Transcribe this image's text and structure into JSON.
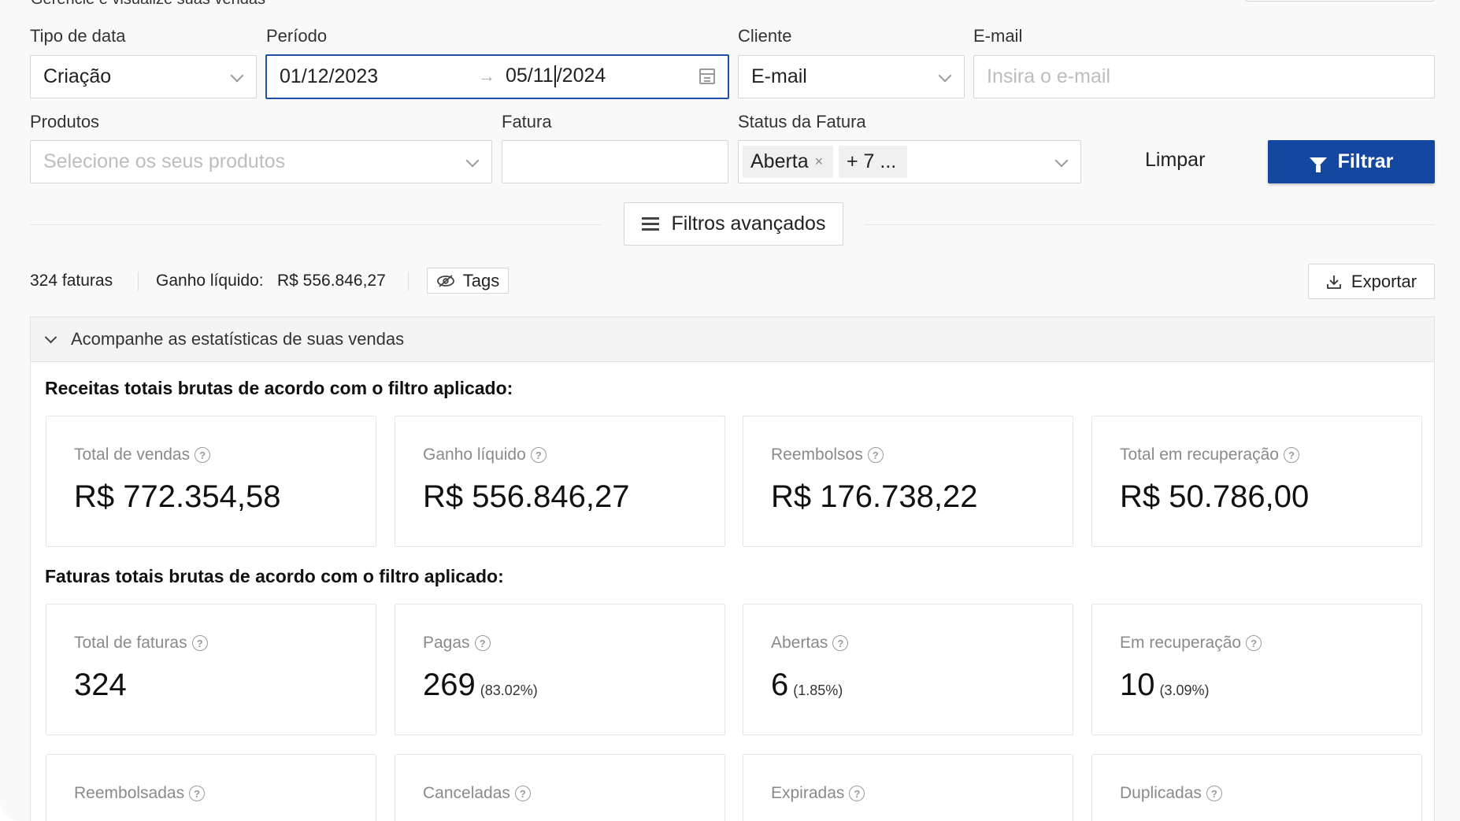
{
  "header": {
    "subtitle": "Gerencie e visualize suas vendas"
  },
  "filters": {
    "date_type": {
      "label": "Tipo de data",
      "value": "Criação"
    },
    "period": {
      "label": "Período",
      "start": "01/12/2023",
      "end_before_caret": "05/11",
      "end_after_caret": "/2024",
      "arrow": "→"
    },
    "client": {
      "label": "Cliente",
      "value": "E-mail"
    },
    "email": {
      "label": "E-mail",
      "placeholder": "Insira o e-mail"
    },
    "products": {
      "label": "Produtos",
      "placeholder": "Selecione os seus produtos"
    },
    "invoice": {
      "label": "Fatura",
      "value": ""
    },
    "invoice_status": {
      "label": "Status da Fatura",
      "tags": [
        "Aberta",
        "+ 7 ..."
      ],
      "remove_glyph": "×"
    },
    "clear_label": "Limpar",
    "filter_label": "Filtrar",
    "advanced_label": "Filtros avançados"
  },
  "summary": {
    "invoices_count": "324 faturas",
    "net_gain_label": "Ganho líquido:",
    "net_gain_value": "R$ 556.846,27",
    "tags_label": "Tags",
    "export_label": "Exportar"
  },
  "stats": {
    "panel_title": "Acompanhe as estatísticas de suas vendas",
    "revenue_title": "Receitas totais brutas de acordo com o filtro aplicado:",
    "revenue_cards": [
      {
        "label": "Total de vendas",
        "value": "R$ 772.354,58"
      },
      {
        "label": "Ganho líquido",
        "value": "R$ 556.846,27"
      },
      {
        "label": "Reembolsos",
        "value": "R$ 176.738,22"
      },
      {
        "label": "Total em recuperação",
        "value": "R$ 50.786,00"
      }
    ],
    "invoices_title": "Faturas totais brutas de acordo com o filtro aplicado:",
    "invoice_cards": [
      {
        "label": "Total de faturas",
        "value": "324",
        "pct": ""
      },
      {
        "label": "Pagas",
        "value": "269",
        "pct": "(83.02%)"
      },
      {
        "label": "Abertas",
        "value": "6",
        "pct": "(1.85%)"
      },
      {
        "label": "Em recuperação",
        "value": "10",
        "pct": "(3.09%)"
      }
    ],
    "more_cards": [
      {
        "label": "Reembolsadas"
      },
      {
        "label": "Canceladas"
      },
      {
        "label": "Expiradas"
      },
      {
        "label": "Duplicadas"
      }
    ],
    "help_glyph": "?"
  },
  "colors": {
    "primary": "#1448a0",
    "active_border": "#1f4fa8",
    "background": "#f9f9f9"
  }
}
